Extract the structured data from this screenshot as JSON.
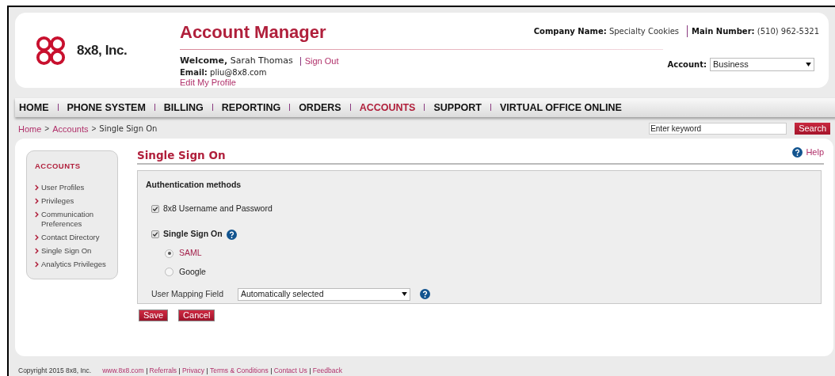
{
  "header": {
    "brand": "8x8, Inc.",
    "title": "Account Manager",
    "welcome_label": "Welcome,",
    "user_name": "Sarah Thomas",
    "sign_out": "Sign Out",
    "email_label": "Email:",
    "email": "pliu@8x8.com",
    "edit_profile": "Edit My Profile",
    "company_label": "Company Name:",
    "company": "Specialty Cookies",
    "number_label": "Main Number:",
    "number": "(510) 962-5321",
    "account_label": "Account:",
    "account_value": "Business"
  },
  "nav": [
    {
      "label": "HOME",
      "selected": false
    },
    {
      "label": "PHONE SYSTEM",
      "selected": false
    },
    {
      "label": "BILLING",
      "selected": false
    },
    {
      "label": "REPORTING",
      "selected": false
    },
    {
      "label": "ORDERS",
      "selected": false
    },
    {
      "label": "ACCOUNTS",
      "selected": true
    },
    {
      "label": "SUPPORT",
      "selected": false
    },
    {
      "label": "VIRTUAL OFFICE ONLINE",
      "selected": false
    }
  ],
  "breadcrumb": [
    {
      "kind": "link",
      "label": "Home"
    },
    {
      "kind": "separator",
      "label": ">"
    },
    {
      "kind": "link",
      "label": "Accounts"
    },
    {
      "kind": "separator",
      "label": ">"
    },
    {
      "kind": "current",
      "label": "Single Sign On"
    }
  ],
  "search": {
    "placeholder": "Enter keyword",
    "button": "Search"
  },
  "sidebar": {
    "title": "ACCOUNTS",
    "items": [
      {
        "label": "User Profiles"
      },
      {
        "label": "Privileges"
      },
      {
        "label": "Communication Preferences"
      },
      {
        "label": "Contact Directory"
      },
      {
        "label": "Single Sign On"
      },
      {
        "label": "Analytics Privileges"
      }
    ]
  },
  "page_title": "Single Sign On",
  "help": "Help",
  "panel": {
    "title": "Authentication methods",
    "options": [
      {
        "label": "8x8 Username and Password",
        "checked": true,
        "help": false
      },
      {
        "label": "Single Sign On",
        "checked": true,
        "help": true
      }
    ],
    "radios": [
      {
        "label": "SAML",
        "selected": true
      },
      {
        "label": "Google",
        "selected": false
      }
    ],
    "mapping_label": "User Mapping Field",
    "mapping_value": "Automatically selected"
  },
  "buttons": [
    "Save",
    "Cancel"
  ],
  "footer": {
    "copyright": "Copyright 2015 8x8, Inc.",
    "links": [
      "www.8x8.com",
      "Referrals",
      "Privacy",
      "Terms & Conditions",
      "Contact Us",
      "Feedback"
    ]
  }
}
